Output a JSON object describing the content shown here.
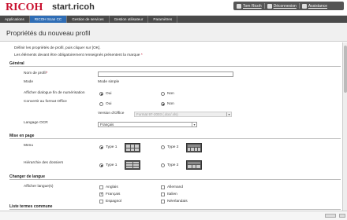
{
  "header": {
    "logo": "RICOH",
    "brand": "start.ricoh",
    "user": "Tom Ricoh",
    "logout": "Déconnexion",
    "help": "Assistance"
  },
  "nav": {
    "tabs": [
      "Applications",
      "RICOH Scan CC",
      "Gestion de services",
      "Gestion utilisateur",
      "Paramètres"
    ]
  },
  "page": {
    "title": "Propriétés du nouveau profil",
    "intro1": "Définir les propriétés de profil, puis cliquer sur [OK].",
    "intro2": "Les éléments devant être obligatoirement renseignés présentent la marque",
    "required_mark": "*"
  },
  "general": {
    "heading": "Général",
    "profile_name_label": "Nom de profil",
    "profile_name_value": "",
    "mode_label": "Mode",
    "mode_value": "Mode simple",
    "dialog_label": "Afficher dialogue fin de numérisation",
    "yes": "Oui",
    "no": "Non",
    "office_label": "Convertir au format Office",
    "office_version_label": "Version d'Office",
    "office_version_value": "Format 97-2003 (.doc/.xls)",
    "ocr_label": "Langage OCR",
    "ocr_value": "Français"
  },
  "layout": {
    "heading": "Mise en page",
    "menu_label": "Menu",
    "folder_label": "Hiérarchie des dossiers",
    "type1": "Type 1",
    "type2": "Type 2"
  },
  "language": {
    "heading": "Changer de langue",
    "display_label": "Afficher langue(s)",
    "langs": [
      "Anglais",
      "Allemand",
      "Français",
      "Italien",
      "Espagnol",
      "Néerlandais"
    ]
  },
  "common": {
    "heading": "Liste termes commune"
  }
}
